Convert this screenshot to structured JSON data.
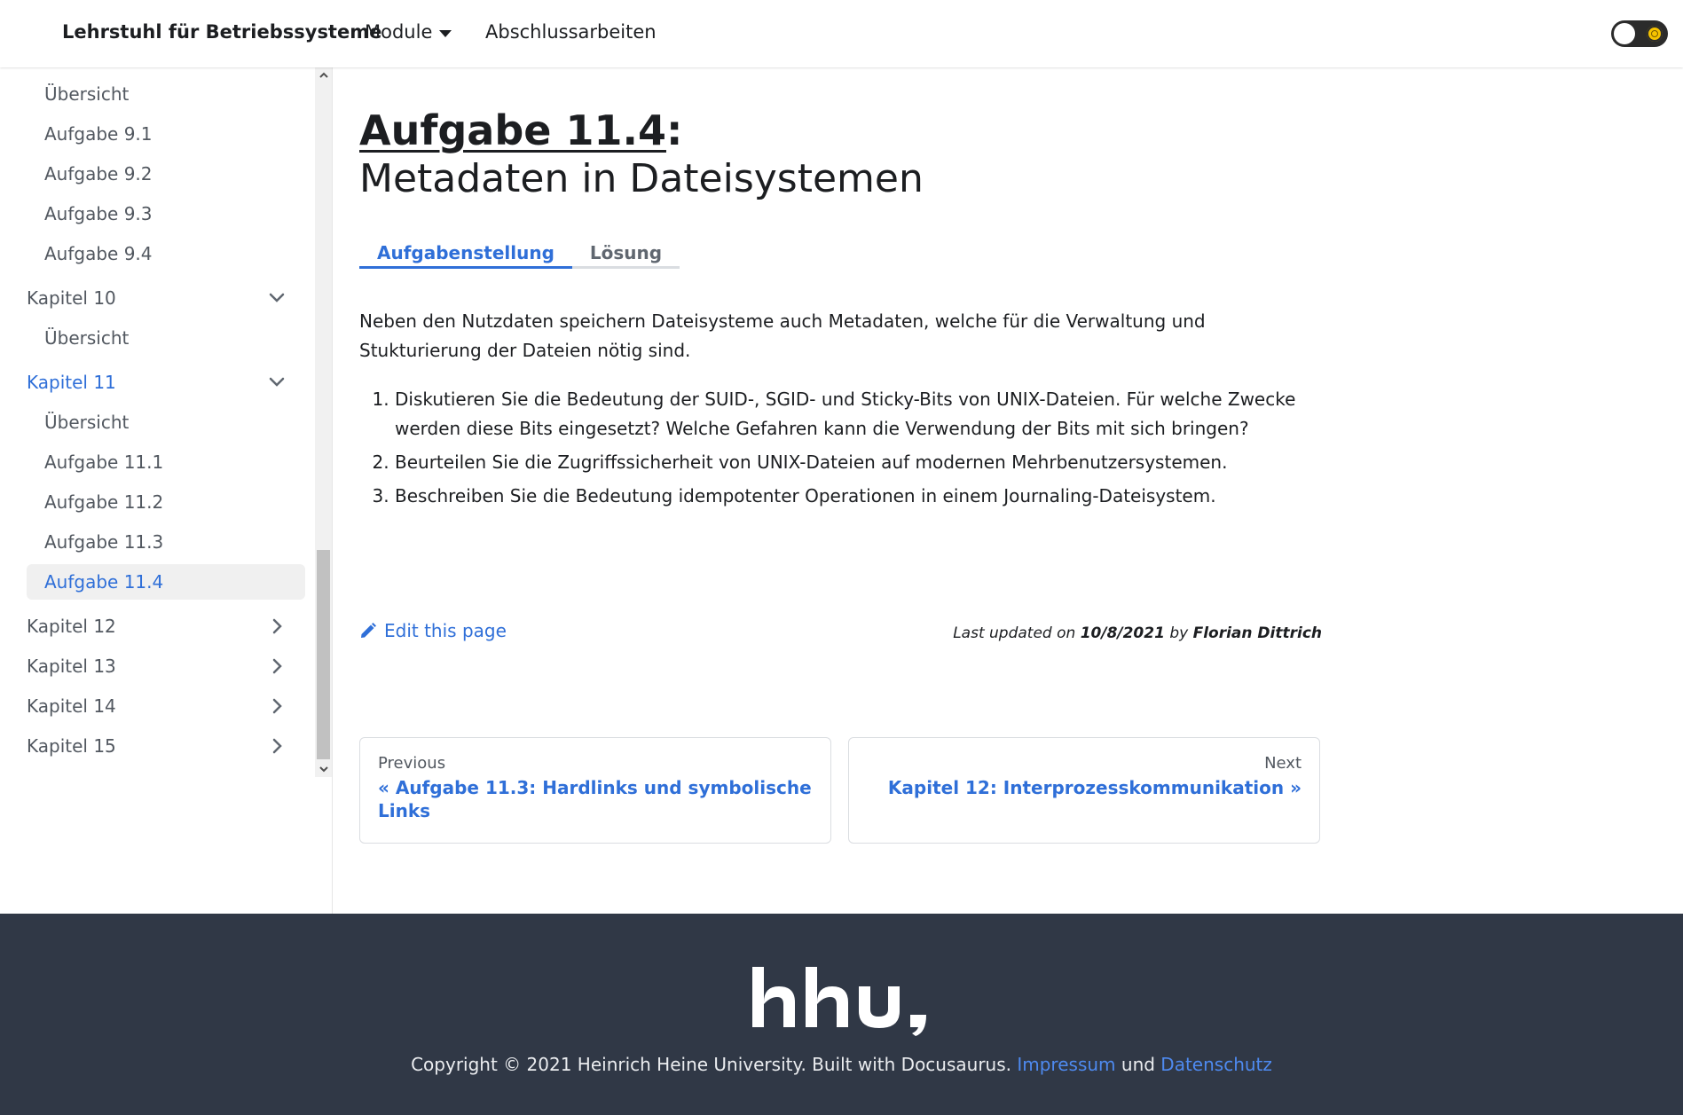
{
  "navbar": {
    "brand": "Lehrstuhl für Betriebssysteme",
    "modules": "Module",
    "theses": "Abschlussarbeiten"
  },
  "sidebar": {
    "items": [
      {
        "label": "Übersicht",
        "type": "sub"
      },
      {
        "label": "Aufgabe 9.1",
        "type": "sub"
      },
      {
        "label": "Aufgabe 9.2",
        "type": "sub"
      },
      {
        "label": "Aufgabe 9.3",
        "type": "sub"
      },
      {
        "label": "Aufgabe 9.4",
        "type": "sub"
      },
      {
        "label": "Kapitel 10",
        "type": "cat"
      },
      {
        "label": "Übersicht",
        "type": "sub"
      },
      {
        "label": "Kapitel 11",
        "type": "cat"
      },
      {
        "label": "Übersicht",
        "type": "sub"
      },
      {
        "label": "Aufgabe 11.1",
        "type": "sub"
      },
      {
        "label": "Aufgabe 11.2",
        "type": "sub"
      },
      {
        "label": "Aufgabe 11.3",
        "type": "sub"
      },
      {
        "label": "Aufgabe 11.4",
        "type": "sub"
      },
      {
        "label": "Kapitel 12",
        "type": "cat"
      },
      {
        "label": "Kapitel 13",
        "type": "cat"
      },
      {
        "label": "Kapitel 14",
        "type": "cat"
      },
      {
        "label": "Kapitel 15",
        "type": "cat"
      }
    ]
  },
  "page": {
    "title_link": "Aufgabe 11.4",
    "title_colon": ":",
    "subtitle": "Metadaten in Dateisystemen",
    "tabs": [
      "Aufgabenstellung",
      "Lösung"
    ],
    "intro": "Neben den Nutzdaten speichern Dateisysteme auch Metadaten, welche für die Verwaltung und Stukturierung der Dateien nötig sind.",
    "tasks": [
      "Diskutieren Sie die Bedeutung der SUID-, SGID- und Sticky-Bits von UNIX-Dateien. Für welche Zwecke werden diese Bits eingesetzt? Welche Gefahren kann die Verwendung der Bits mit sich bringen?",
      "Beurteilen Sie die Zugriffssicherheit von UNIX-Dateien auf modernen Mehrbenutzersystemen.",
      "Beschreiben Sie die Bedeutung idempotenter Operationen in einem Journaling-Dateisystem."
    ],
    "edit_link": "Edit this page",
    "last_updated_prefix": "Last updated on ",
    "last_updated_date": "10/8/2021",
    "last_updated_by": " by ",
    "last_updated_author": "Florian Dittrich"
  },
  "pager": {
    "prev_sub": "Previous",
    "prev_label": "« Aufgabe 11.3: Hardlinks und symbolische Links",
    "next_sub": "Next",
    "next_label": "Kapitel 12: Interprozesskommunikation »"
  },
  "footer": {
    "logo_text": "hhu.",
    "copyright": "Copyright © 2021 Heinrich Heine University. Built with Docusaurus. ",
    "impressum": "Impressum",
    "und": " und ",
    "datenschutz": "Datenschutz"
  },
  "colors": {
    "accent": "#2f6fd8",
    "footer_bg": "#303846",
    "text": "#1c1e21"
  }
}
